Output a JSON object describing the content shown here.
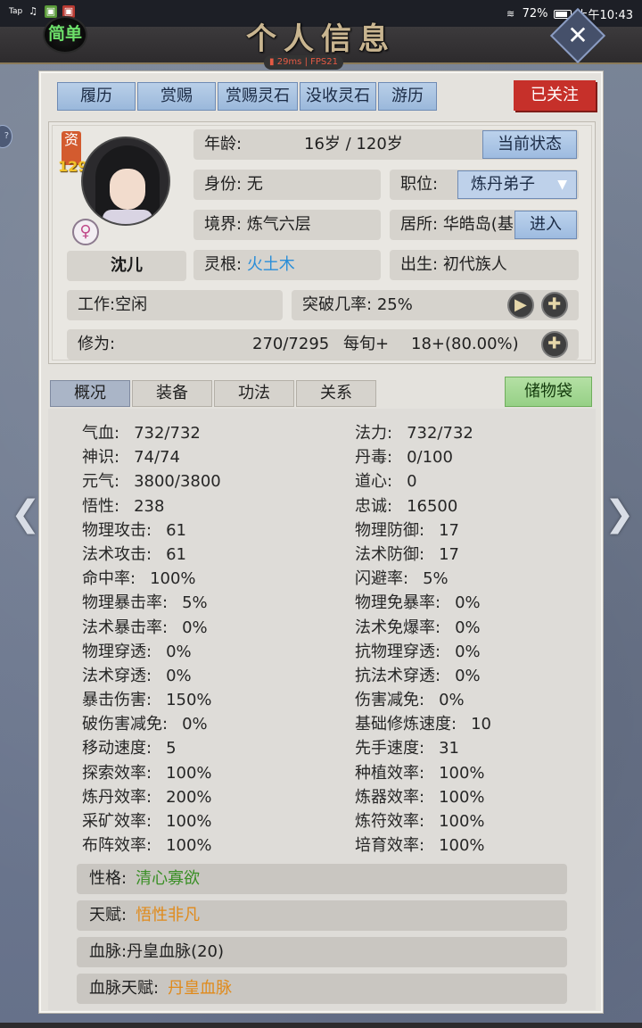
{
  "status_bar": {
    "left_icons": [
      "tap-icon",
      "music-icon",
      "app-icon",
      "game-icon"
    ],
    "tap_label": "Tap",
    "battery_percent": "72%",
    "time": "上午10:43"
  },
  "header": {
    "title": "个人信息",
    "mode_badge": "简单",
    "net_latency": "29ms",
    "net_fps": "FPS21",
    "close_glyph": "✕"
  },
  "top_buttons": [
    "履历",
    "赏赐",
    "赏赐灵石",
    "没收灵石",
    "游历"
  ],
  "followed_label": "已关注",
  "character": {
    "aptitude_label": "资",
    "aptitude_value": "129",
    "gender_glyph": "♀",
    "name": "沈儿",
    "age_label": "年龄:",
    "age_value": "16岁 / 120岁",
    "current_state_button": "当前状态",
    "identity_label": "身份:",
    "identity_value": "无",
    "position_label": "职位:",
    "position_value": "炼丹弟子",
    "realm_label": "境界:",
    "realm_value": "炼气六层",
    "residence_label": "居所:",
    "residence_value": "华皓岛(基",
    "enter_button": "进入",
    "root_label": "灵根:",
    "root_value": "火土木",
    "birth_label": "出生:",
    "birth_value": "初代族人",
    "job_label": "工作:",
    "job_value": "空闲",
    "breakthrough_label": "突破几率:",
    "breakthrough_value": "25%",
    "cultivation_label": "修为:",
    "cultivation_value": "270/7295",
    "per_round_label": "每旬+",
    "per_round_value": "18+(80.00%)"
  },
  "tabs": [
    "概况",
    "装备",
    "功法",
    "关系"
  ],
  "bag_button": "储物袋",
  "stats_left": [
    {
      "label": "气血:",
      "value": "732/732"
    },
    {
      "label": "神识:",
      "value": "74/74"
    },
    {
      "label": "元气:",
      "value": "3800/3800"
    },
    {
      "label": "悟性:",
      "value": "238"
    },
    {
      "label": "物理攻击:",
      "value": "61"
    },
    {
      "label": "法术攻击:",
      "value": "61"
    },
    {
      "label": "命中率:",
      "value": "100%"
    },
    {
      "label": "物理暴击率:",
      "value": "5%"
    },
    {
      "label": "法术暴击率:",
      "value": "0%"
    },
    {
      "label": "物理穿透:",
      "value": "0%"
    },
    {
      "label": "法术穿透:",
      "value": "0%"
    },
    {
      "label": "暴击伤害:",
      "value": "150%"
    },
    {
      "label": "破伤害减免:",
      "value": "0%"
    },
    {
      "label": "移动速度:",
      "value": "5"
    },
    {
      "label": "探索效率:",
      "value": "100%"
    },
    {
      "label": "炼丹效率:",
      "value": "200%"
    },
    {
      "label": "采矿效率:",
      "value": "100%"
    },
    {
      "label": "布阵效率:",
      "value": "100%"
    }
  ],
  "stats_right": [
    {
      "label": "法力:",
      "value": "732/732"
    },
    {
      "label": "丹毒:",
      "value": "0/100"
    },
    {
      "label": "道心:",
      "value": "0"
    },
    {
      "label": "忠诚:",
      "value": "16500"
    },
    {
      "label": "物理防御:",
      "value": "17"
    },
    {
      "label": "法术防御:",
      "value": "17"
    },
    {
      "label": "闪避率:",
      "value": "5%"
    },
    {
      "label": "物理免暴率:",
      "value": "0%"
    },
    {
      "label": "法术免爆率:",
      "value": "0%"
    },
    {
      "label": "抗物理穿透:",
      "value": "0%"
    },
    {
      "label": "抗法术穿透:",
      "value": "0%"
    },
    {
      "label": "伤害减免:",
      "value": "0%"
    },
    {
      "label": "基础修炼速度:",
      "value": "10"
    },
    {
      "label": "先手速度:",
      "value": "31"
    },
    {
      "label": "种植效率:",
      "value": "100%"
    },
    {
      "label": "炼器效率:",
      "value": "100%"
    },
    {
      "label": "炼符效率:",
      "value": "100%"
    },
    {
      "label": "培育效率:",
      "value": "100%"
    }
  ],
  "traits": [
    {
      "label": "性格:",
      "value": "清心寡欲",
      "color": "#3a8f26"
    },
    {
      "label": "天赋:",
      "value": "悟性非凡",
      "color": "#e08a1a"
    },
    {
      "label": "血脉:",
      "value": "丹皇血脉(20)",
      "color": "#1f1f1f"
    },
    {
      "label": "血脉天赋:",
      "value": "丹皇血脉",
      "color": "#e08a1a"
    }
  ],
  "side_chip": "?",
  "nav": {
    "prev_glyph": "❮",
    "next_glyph": "❯"
  }
}
